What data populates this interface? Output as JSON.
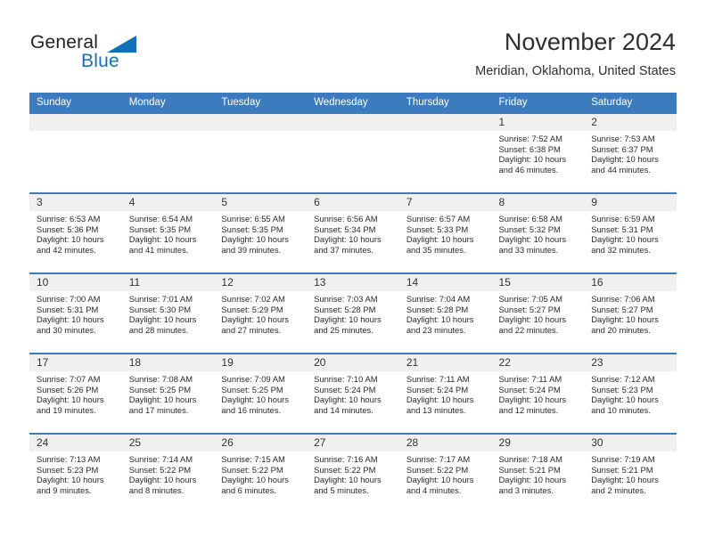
{
  "brand": {
    "name_part1": "General",
    "name_part2": "Blue",
    "triangle_icon": "triangle-logo-icon",
    "accent_color": "#1271b9"
  },
  "header": {
    "title": "November 2024",
    "subtitle": "Meridian, Oklahoma, United States"
  },
  "theme": {
    "header_blue": "#3c7cbe",
    "daynum_band": "#f0f0f0",
    "text": "#2a2a2a"
  },
  "calendar": {
    "weekdays": [
      "Sunday",
      "Monday",
      "Tuesday",
      "Wednesday",
      "Thursday",
      "Friday",
      "Saturday"
    ],
    "weeks": [
      [
        {
          "day": "",
          "sunrise": "",
          "sunset": "",
          "daylight_1": "",
          "daylight_2": ""
        },
        {
          "day": "",
          "sunrise": "",
          "sunset": "",
          "daylight_1": "",
          "daylight_2": ""
        },
        {
          "day": "",
          "sunrise": "",
          "sunset": "",
          "daylight_1": "",
          "daylight_2": ""
        },
        {
          "day": "",
          "sunrise": "",
          "sunset": "",
          "daylight_1": "",
          "daylight_2": ""
        },
        {
          "day": "",
          "sunrise": "",
          "sunset": "",
          "daylight_1": "",
          "daylight_2": ""
        },
        {
          "day": "1",
          "sunrise": "Sunrise: 7:52 AM",
          "sunset": "Sunset: 6:38 PM",
          "daylight_1": "Daylight: 10 hours",
          "daylight_2": "and 46 minutes."
        },
        {
          "day": "2",
          "sunrise": "Sunrise: 7:53 AM",
          "sunset": "Sunset: 6:37 PM",
          "daylight_1": "Daylight: 10 hours",
          "daylight_2": "and 44 minutes."
        }
      ],
      [
        {
          "day": "3",
          "sunrise": "Sunrise: 6:53 AM",
          "sunset": "Sunset: 5:36 PM",
          "daylight_1": "Daylight: 10 hours",
          "daylight_2": "and 42 minutes."
        },
        {
          "day": "4",
          "sunrise": "Sunrise: 6:54 AM",
          "sunset": "Sunset: 5:35 PM",
          "daylight_1": "Daylight: 10 hours",
          "daylight_2": "and 41 minutes."
        },
        {
          "day": "5",
          "sunrise": "Sunrise: 6:55 AM",
          "sunset": "Sunset: 5:35 PM",
          "daylight_1": "Daylight: 10 hours",
          "daylight_2": "and 39 minutes."
        },
        {
          "day": "6",
          "sunrise": "Sunrise: 6:56 AM",
          "sunset": "Sunset: 5:34 PM",
          "daylight_1": "Daylight: 10 hours",
          "daylight_2": "and 37 minutes."
        },
        {
          "day": "7",
          "sunrise": "Sunrise: 6:57 AM",
          "sunset": "Sunset: 5:33 PM",
          "daylight_1": "Daylight: 10 hours",
          "daylight_2": "and 35 minutes."
        },
        {
          "day": "8",
          "sunrise": "Sunrise: 6:58 AM",
          "sunset": "Sunset: 5:32 PM",
          "daylight_1": "Daylight: 10 hours",
          "daylight_2": "and 33 minutes."
        },
        {
          "day": "9",
          "sunrise": "Sunrise: 6:59 AM",
          "sunset": "Sunset: 5:31 PM",
          "daylight_1": "Daylight: 10 hours",
          "daylight_2": "and 32 minutes."
        }
      ],
      [
        {
          "day": "10",
          "sunrise": "Sunrise: 7:00 AM",
          "sunset": "Sunset: 5:31 PM",
          "daylight_1": "Daylight: 10 hours",
          "daylight_2": "and 30 minutes."
        },
        {
          "day": "11",
          "sunrise": "Sunrise: 7:01 AM",
          "sunset": "Sunset: 5:30 PM",
          "daylight_1": "Daylight: 10 hours",
          "daylight_2": "and 28 minutes."
        },
        {
          "day": "12",
          "sunrise": "Sunrise: 7:02 AM",
          "sunset": "Sunset: 5:29 PM",
          "daylight_1": "Daylight: 10 hours",
          "daylight_2": "and 27 minutes."
        },
        {
          "day": "13",
          "sunrise": "Sunrise: 7:03 AM",
          "sunset": "Sunset: 5:28 PM",
          "daylight_1": "Daylight: 10 hours",
          "daylight_2": "and 25 minutes."
        },
        {
          "day": "14",
          "sunrise": "Sunrise: 7:04 AM",
          "sunset": "Sunset: 5:28 PM",
          "daylight_1": "Daylight: 10 hours",
          "daylight_2": "and 23 minutes."
        },
        {
          "day": "15",
          "sunrise": "Sunrise: 7:05 AM",
          "sunset": "Sunset: 5:27 PM",
          "daylight_1": "Daylight: 10 hours",
          "daylight_2": "and 22 minutes."
        },
        {
          "day": "16",
          "sunrise": "Sunrise: 7:06 AM",
          "sunset": "Sunset: 5:27 PM",
          "daylight_1": "Daylight: 10 hours",
          "daylight_2": "and 20 minutes."
        }
      ],
      [
        {
          "day": "17",
          "sunrise": "Sunrise: 7:07 AM",
          "sunset": "Sunset: 5:26 PM",
          "daylight_1": "Daylight: 10 hours",
          "daylight_2": "and 19 minutes."
        },
        {
          "day": "18",
          "sunrise": "Sunrise: 7:08 AM",
          "sunset": "Sunset: 5:25 PM",
          "daylight_1": "Daylight: 10 hours",
          "daylight_2": "and 17 minutes."
        },
        {
          "day": "19",
          "sunrise": "Sunrise: 7:09 AM",
          "sunset": "Sunset: 5:25 PM",
          "daylight_1": "Daylight: 10 hours",
          "daylight_2": "and 16 minutes."
        },
        {
          "day": "20",
          "sunrise": "Sunrise: 7:10 AM",
          "sunset": "Sunset: 5:24 PM",
          "daylight_1": "Daylight: 10 hours",
          "daylight_2": "and 14 minutes."
        },
        {
          "day": "21",
          "sunrise": "Sunrise: 7:11 AM",
          "sunset": "Sunset: 5:24 PM",
          "daylight_1": "Daylight: 10 hours",
          "daylight_2": "and 13 minutes."
        },
        {
          "day": "22",
          "sunrise": "Sunrise: 7:11 AM",
          "sunset": "Sunset: 5:24 PM",
          "daylight_1": "Daylight: 10 hours",
          "daylight_2": "and 12 minutes."
        },
        {
          "day": "23",
          "sunrise": "Sunrise: 7:12 AM",
          "sunset": "Sunset: 5:23 PM",
          "daylight_1": "Daylight: 10 hours",
          "daylight_2": "and 10 minutes."
        }
      ],
      [
        {
          "day": "24",
          "sunrise": "Sunrise: 7:13 AM",
          "sunset": "Sunset: 5:23 PM",
          "daylight_1": "Daylight: 10 hours",
          "daylight_2": "and 9 minutes."
        },
        {
          "day": "25",
          "sunrise": "Sunrise: 7:14 AM",
          "sunset": "Sunset: 5:22 PM",
          "daylight_1": "Daylight: 10 hours",
          "daylight_2": "and 8 minutes."
        },
        {
          "day": "26",
          "sunrise": "Sunrise: 7:15 AM",
          "sunset": "Sunset: 5:22 PM",
          "daylight_1": "Daylight: 10 hours",
          "daylight_2": "and 6 minutes."
        },
        {
          "day": "27",
          "sunrise": "Sunrise: 7:16 AM",
          "sunset": "Sunset: 5:22 PM",
          "daylight_1": "Daylight: 10 hours",
          "daylight_2": "and 5 minutes."
        },
        {
          "day": "28",
          "sunrise": "Sunrise: 7:17 AM",
          "sunset": "Sunset: 5:22 PM",
          "daylight_1": "Daylight: 10 hours",
          "daylight_2": "and 4 minutes."
        },
        {
          "day": "29",
          "sunrise": "Sunrise: 7:18 AM",
          "sunset": "Sunset: 5:21 PM",
          "daylight_1": "Daylight: 10 hours",
          "daylight_2": "and 3 minutes."
        },
        {
          "day": "30",
          "sunrise": "Sunrise: 7:19 AM",
          "sunset": "Sunset: 5:21 PM",
          "daylight_1": "Daylight: 10 hours",
          "daylight_2": "and 2 minutes."
        }
      ]
    ]
  }
}
